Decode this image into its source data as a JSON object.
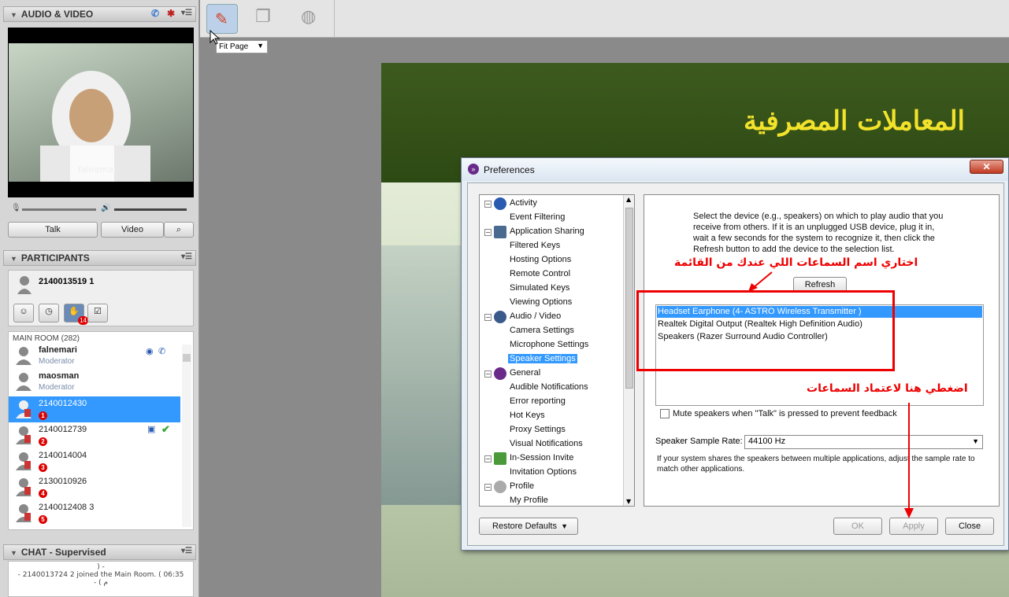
{
  "left_panel": {
    "audio_video": {
      "title": "AUDIO & VIDEO",
      "video_name": "falnemari",
      "talk_label": "Talk",
      "video_label": "Video"
    },
    "participants": {
      "title": "PARTICIPANTS",
      "current_user": "2140013519 1",
      "hand_count": "14",
      "room_label": "MAIN ROOM",
      "room_count": "(282)"
    },
    "list": [
      {
        "name": "falnemari",
        "role": "Moderator"
      },
      {
        "name": "maosman",
        "role": "Moderator"
      },
      {
        "name": "2140012430",
        "badge": "1"
      },
      {
        "name": "2140012739",
        "badge": "2"
      },
      {
        "name": "2140014004",
        "badge": "3"
      },
      {
        "name": "2130010926",
        "badge": "4"
      },
      {
        "name": "2140012408 3",
        "badge": "5"
      }
    ],
    "chat": {
      "title": "CHAT - Supervised",
      "line1": ") -",
      "line2": "- 2140013724 2 joined the Main Room. ( 06:35",
      "line3": "- ( م"
    }
  },
  "toolbar": {
    "fit_page": "Fit Page"
  },
  "slide": {
    "title": "المعاملات المصرفية"
  },
  "preferences": {
    "title": "Preferences",
    "tree": {
      "activity": "Activity",
      "event_filtering": "Event Filtering",
      "app_sharing": "Application Sharing",
      "filtered_keys": "Filtered Keys",
      "hosting_options": "Hosting Options",
      "remote_control": "Remote Control",
      "simulated_keys": "Simulated Keys",
      "viewing_options": "Viewing Options",
      "audio_video": "Audio / Video",
      "camera_settings": "Camera Settings",
      "microphone_settings": "Microphone Settings",
      "speaker_settings": "Speaker Settings",
      "general": "General",
      "audible_notifications": "Audible Notifications",
      "error_reporting": "Error reporting",
      "hot_keys": "Hot Keys",
      "proxy_settings": "Proxy Settings",
      "visual_notifications": "Visual Notifications",
      "in_session_invite": "In-Session Invite",
      "invitation_options": "Invitation Options",
      "profile": "Profile",
      "my_profile": "My Profile"
    },
    "desc_line1": "Select the device (e.g., speakers) on which to play audio that you",
    "desc_line2": "receive from others. If it is an unplugged USB device, plug it in,",
    "desc_line3": "wait a few seconds for the system to recognize it, then click the",
    "desc_line4": "Refresh button to add the device to the selection list.",
    "refresh_label": "Refresh",
    "devices": [
      "Headset Earphone (4- ASTRO Wireless Transmitter )",
      "Realtek Digital Output (Realtek High Definition Audio)",
      "Speakers (Razer Surround Audio Controller)"
    ],
    "mute_label": "Mute speakers when \"Talk\" is pressed to prevent feedback",
    "sample_rate_label": "Speaker Sample Rate:",
    "sample_rate_value": "44100 Hz",
    "sample_note": "If your system shares the speakers between multiple applications, adjust the sample rate to match other applications.",
    "restore_label": "Restore Defaults",
    "ok_label": "OK",
    "apply_label": "Apply",
    "close_label": "Close"
  },
  "annotations": {
    "choose_speakers": "اختاري اسم السماعات اللي عندك من القائمة",
    "click_here": "اضغطي هنا لاعتماد السماعات"
  }
}
